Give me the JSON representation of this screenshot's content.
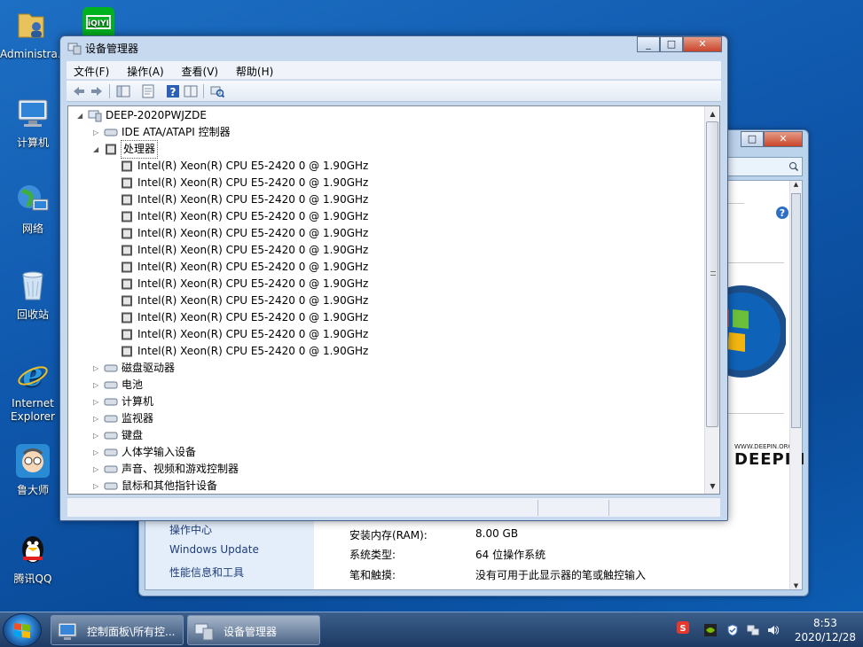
{
  "desktop_icons": [
    {
      "name": "administrator-folder",
      "label": "Administra..."
    },
    {
      "name": "computer",
      "label": "计算机"
    },
    {
      "name": "network",
      "label": "网络"
    },
    {
      "name": "recycle-bin",
      "label": "回收站"
    },
    {
      "name": "internet-explorer",
      "label": "Internet Explorer"
    },
    {
      "name": "ludashi",
      "label": "鲁大师"
    },
    {
      "name": "tencent-qq",
      "label": "腾讯QQ"
    },
    {
      "name": "iqiyi",
      "label": "iQIYI"
    }
  ],
  "control_panel": {
    "links": [
      "操作中心",
      "Windows Update",
      "性能信息和工具"
    ],
    "system": [
      {
        "label": "安装内存(RAM):",
        "value": "8.00 GB"
      },
      {
        "label": "系统类型:",
        "value": "64 位操作系统"
      },
      {
        "label": "笔和触摸:",
        "value": "没有可用于此显示器的笔或触控输入"
      }
    ],
    "brand": "DEEPIN",
    "brand_small": "WWW.DEEPIN.ORG"
  },
  "device_manager": {
    "title": "设备管理器",
    "menu": [
      "文件(F)",
      "操作(A)",
      "查看(V)",
      "帮助(H)"
    ],
    "root": "DEEP-2020PWJZDE",
    "categories_top": [
      {
        "label": "IDE ATA/ATAPI 控制器",
        "icon": "ide-controller-icon"
      },
      {
        "label": "处理器",
        "icon": "processor-icon"
      }
    ],
    "processors": [
      "Intel(R) Xeon(R) CPU E5-2420 0 @ 1.90GHz",
      "Intel(R) Xeon(R) CPU E5-2420 0 @ 1.90GHz",
      "Intel(R) Xeon(R) CPU E5-2420 0 @ 1.90GHz",
      "Intel(R) Xeon(R) CPU E5-2420 0 @ 1.90GHz",
      "Intel(R) Xeon(R) CPU E5-2420 0 @ 1.90GHz",
      "Intel(R) Xeon(R) CPU E5-2420 0 @ 1.90GHz",
      "Intel(R) Xeon(R) CPU E5-2420 0 @ 1.90GHz",
      "Intel(R) Xeon(R) CPU E5-2420 0 @ 1.90GHz",
      "Intel(R) Xeon(R) CPU E5-2420 0 @ 1.90GHz",
      "Intel(R) Xeon(R) CPU E5-2420 0 @ 1.90GHz",
      "Intel(R) Xeon(R) CPU E5-2420 0 @ 1.90GHz",
      "Intel(R) Xeon(R) CPU E5-2420 0 @ 1.90GHz"
    ],
    "categories_bottom": [
      {
        "label": "磁盘驱动器",
        "icon": "disk-drive-icon"
      },
      {
        "label": "电池",
        "icon": "battery-icon"
      },
      {
        "label": "计算机",
        "icon": "computer-icon"
      },
      {
        "label": "监视器",
        "icon": "monitor-icon"
      },
      {
        "label": "键盘",
        "icon": "keyboard-icon"
      },
      {
        "label": "人体学输入设备",
        "icon": "hid-icon"
      },
      {
        "label": "声音、视频和游戏控制器",
        "icon": "sound-icon"
      },
      {
        "label": "鼠标和其他指针设备",
        "icon": "mouse-icon"
      }
    ]
  },
  "taskbar": {
    "tasks": [
      {
        "label": "控制面板\\所有控...",
        "icon": "control-panel-icon",
        "active": false
      },
      {
        "label": "设备管理器",
        "icon": "device-manager-icon",
        "active": true
      }
    ],
    "time": "8:53",
    "date": "2020/12/28"
  },
  "colors": {
    "desktop": "#1160b4",
    "taskbar": "#1d3a64",
    "window_frame": "#c6d9ef"
  }
}
